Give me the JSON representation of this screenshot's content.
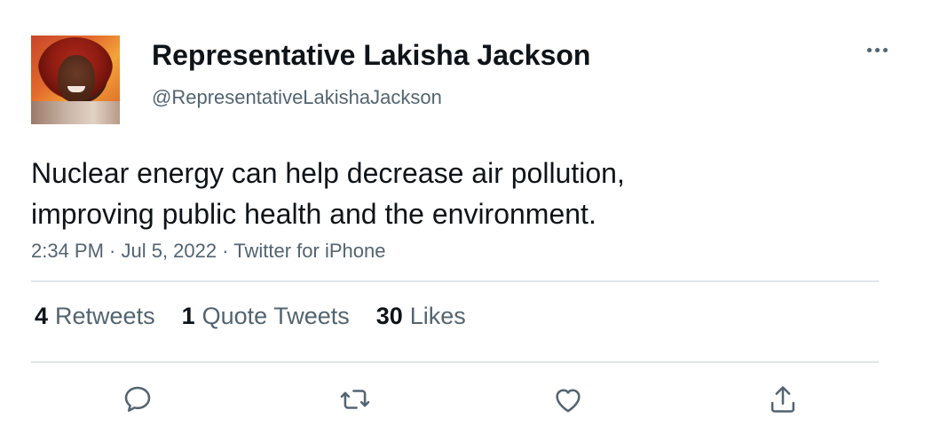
{
  "user": {
    "display_name": "Representative Lakisha Jackson",
    "handle": "@RepresentativeLakishaJackson"
  },
  "tweet": {
    "lines": [
      "Nuclear energy can help decrease air pollution,",
      "improving public health and the environment."
    ],
    "meta": "2:34 PM · Jul 5, 2022 · Twitter for iPhone"
  },
  "stats": [
    {
      "count": "4",
      "label": "Retweets"
    },
    {
      "count": "1",
      "label": "Quote Tweets"
    },
    {
      "count": "30",
      "label": "Likes"
    }
  ],
  "actions": [
    {
      "icon": "reply-icon"
    },
    {
      "icon": "retweet-icon"
    },
    {
      "icon": "like-icon"
    },
    {
      "icon": "share-icon"
    }
  ],
  "colors": {
    "text_primary": "#0f1419",
    "text_secondary": "#536471",
    "divider": "#e1e6ea"
  }
}
